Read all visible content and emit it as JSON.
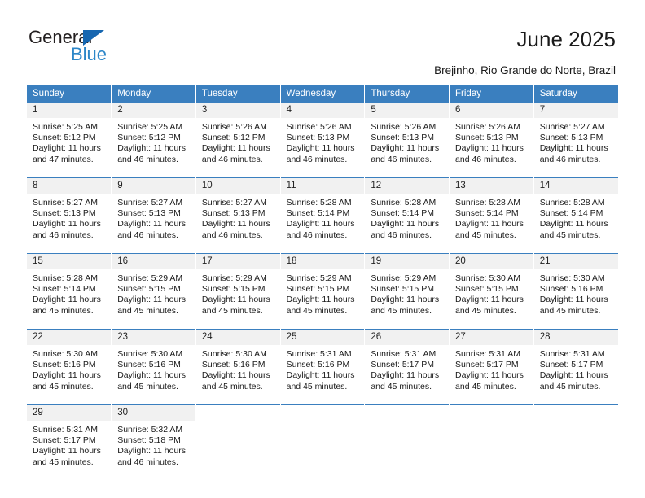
{
  "brand": {
    "name_top": "General",
    "name_bottom": "Blue",
    "triangle_color": "#1666b0",
    "blue_color": "#2c86c8"
  },
  "header": {
    "title": "June 2025",
    "location": "Brejinho, Rio Grande do Norte, Brazil"
  },
  "theme": {
    "header_blue": "#3a7fbf",
    "daynum_band": "#f1f1f1",
    "text": "#1a1a1a"
  },
  "weekdays": [
    "Sunday",
    "Monday",
    "Tuesday",
    "Wednesday",
    "Thursday",
    "Friday",
    "Saturday"
  ],
  "weeks": [
    [
      {
        "day": "1",
        "sunrise": "Sunrise: 5:25 AM",
        "sunset": "Sunset: 5:12 PM",
        "daylight1": "Daylight: 11 hours",
        "daylight2": "and 47 minutes."
      },
      {
        "day": "2",
        "sunrise": "Sunrise: 5:25 AM",
        "sunset": "Sunset: 5:12 PM",
        "daylight1": "Daylight: 11 hours",
        "daylight2": "and 46 minutes."
      },
      {
        "day": "3",
        "sunrise": "Sunrise: 5:26 AM",
        "sunset": "Sunset: 5:12 PM",
        "daylight1": "Daylight: 11 hours",
        "daylight2": "and 46 minutes."
      },
      {
        "day": "4",
        "sunrise": "Sunrise: 5:26 AM",
        "sunset": "Sunset: 5:13 PM",
        "daylight1": "Daylight: 11 hours",
        "daylight2": "and 46 minutes."
      },
      {
        "day": "5",
        "sunrise": "Sunrise: 5:26 AM",
        "sunset": "Sunset: 5:13 PM",
        "daylight1": "Daylight: 11 hours",
        "daylight2": "and 46 minutes."
      },
      {
        "day": "6",
        "sunrise": "Sunrise: 5:26 AM",
        "sunset": "Sunset: 5:13 PM",
        "daylight1": "Daylight: 11 hours",
        "daylight2": "and 46 minutes."
      },
      {
        "day": "7",
        "sunrise": "Sunrise: 5:27 AM",
        "sunset": "Sunset: 5:13 PM",
        "daylight1": "Daylight: 11 hours",
        "daylight2": "and 46 minutes."
      }
    ],
    [
      {
        "day": "8",
        "sunrise": "Sunrise: 5:27 AM",
        "sunset": "Sunset: 5:13 PM",
        "daylight1": "Daylight: 11 hours",
        "daylight2": "and 46 minutes."
      },
      {
        "day": "9",
        "sunrise": "Sunrise: 5:27 AM",
        "sunset": "Sunset: 5:13 PM",
        "daylight1": "Daylight: 11 hours",
        "daylight2": "and 46 minutes."
      },
      {
        "day": "10",
        "sunrise": "Sunrise: 5:27 AM",
        "sunset": "Sunset: 5:13 PM",
        "daylight1": "Daylight: 11 hours",
        "daylight2": "and 46 minutes."
      },
      {
        "day": "11",
        "sunrise": "Sunrise: 5:28 AM",
        "sunset": "Sunset: 5:14 PM",
        "daylight1": "Daylight: 11 hours",
        "daylight2": "and 46 minutes."
      },
      {
        "day": "12",
        "sunrise": "Sunrise: 5:28 AM",
        "sunset": "Sunset: 5:14 PM",
        "daylight1": "Daylight: 11 hours",
        "daylight2": "and 46 minutes."
      },
      {
        "day": "13",
        "sunrise": "Sunrise: 5:28 AM",
        "sunset": "Sunset: 5:14 PM",
        "daylight1": "Daylight: 11 hours",
        "daylight2": "and 45 minutes."
      },
      {
        "day": "14",
        "sunrise": "Sunrise: 5:28 AM",
        "sunset": "Sunset: 5:14 PM",
        "daylight1": "Daylight: 11 hours",
        "daylight2": "and 45 minutes."
      }
    ],
    [
      {
        "day": "15",
        "sunrise": "Sunrise: 5:28 AM",
        "sunset": "Sunset: 5:14 PM",
        "daylight1": "Daylight: 11 hours",
        "daylight2": "and 45 minutes."
      },
      {
        "day": "16",
        "sunrise": "Sunrise: 5:29 AM",
        "sunset": "Sunset: 5:15 PM",
        "daylight1": "Daylight: 11 hours",
        "daylight2": "and 45 minutes."
      },
      {
        "day": "17",
        "sunrise": "Sunrise: 5:29 AM",
        "sunset": "Sunset: 5:15 PM",
        "daylight1": "Daylight: 11 hours",
        "daylight2": "and 45 minutes."
      },
      {
        "day": "18",
        "sunrise": "Sunrise: 5:29 AM",
        "sunset": "Sunset: 5:15 PM",
        "daylight1": "Daylight: 11 hours",
        "daylight2": "and 45 minutes."
      },
      {
        "day": "19",
        "sunrise": "Sunrise: 5:29 AM",
        "sunset": "Sunset: 5:15 PM",
        "daylight1": "Daylight: 11 hours",
        "daylight2": "and 45 minutes."
      },
      {
        "day": "20",
        "sunrise": "Sunrise: 5:30 AM",
        "sunset": "Sunset: 5:15 PM",
        "daylight1": "Daylight: 11 hours",
        "daylight2": "and 45 minutes."
      },
      {
        "day": "21",
        "sunrise": "Sunrise: 5:30 AM",
        "sunset": "Sunset: 5:16 PM",
        "daylight1": "Daylight: 11 hours",
        "daylight2": "and 45 minutes."
      }
    ],
    [
      {
        "day": "22",
        "sunrise": "Sunrise: 5:30 AM",
        "sunset": "Sunset: 5:16 PM",
        "daylight1": "Daylight: 11 hours",
        "daylight2": "and 45 minutes."
      },
      {
        "day": "23",
        "sunrise": "Sunrise: 5:30 AM",
        "sunset": "Sunset: 5:16 PM",
        "daylight1": "Daylight: 11 hours",
        "daylight2": "and 45 minutes."
      },
      {
        "day": "24",
        "sunrise": "Sunrise: 5:30 AM",
        "sunset": "Sunset: 5:16 PM",
        "daylight1": "Daylight: 11 hours",
        "daylight2": "and 45 minutes."
      },
      {
        "day": "25",
        "sunrise": "Sunrise: 5:31 AM",
        "sunset": "Sunset: 5:16 PM",
        "daylight1": "Daylight: 11 hours",
        "daylight2": "and 45 minutes."
      },
      {
        "day": "26",
        "sunrise": "Sunrise: 5:31 AM",
        "sunset": "Sunset: 5:17 PM",
        "daylight1": "Daylight: 11 hours",
        "daylight2": "and 45 minutes."
      },
      {
        "day": "27",
        "sunrise": "Sunrise: 5:31 AM",
        "sunset": "Sunset: 5:17 PM",
        "daylight1": "Daylight: 11 hours",
        "daylight2": "and 45 minutes."
      },
      {
        "day": "28",
        "sunrise": "Sunrise: 5:31 AM",
        "sunset": "Sunset: 5:17 PM",
        "daylight1": "Daylight: 11 hours",
        "daylight2": "and 45 minutes."
      }
    ],
    [
      {
        "day": "29",
        "sunrise": "Sunrise: 5:31 AM",
        "sunset": "Sunset: 5:17 PM",
        "daylight1": "Daylight: 11 hours",
        "daylight2": "and 45 minutes."
      },
      {
        "day": "30",
        "sunrise": "Sunrise: 5:32 AM",
        "sunset": "Sunset: 5:18 PM",
        "daylight1": "Daylight: 11 hours",
        "daylight2": "and 46 minutes."
      },
      {
        "day": "",
        "sunrise": "",
        "sunset": "",
        "daylight1": "",
        "daylight2": ""
      },
      {
        "day": "",
        "sunrise": "",
        "sunset": "",
        "daylight1": "",
        "daylight2": ""
      },
      {
        "day": "",
        "sunrise": "",
        "sunset": "",
        "daylight1": "",
        "daylight2": ""
      },
      {
        "day": "",
        "sunrise": "",
        "sunset": "",
        "daylight1": "",
        "daylight2": ""
      },
      {
        "day": "",
        "sunrise": "",
        "sunset": "",
        "daylight1": "",
        "daylight2": ""
      }
    ]
  ]
}
